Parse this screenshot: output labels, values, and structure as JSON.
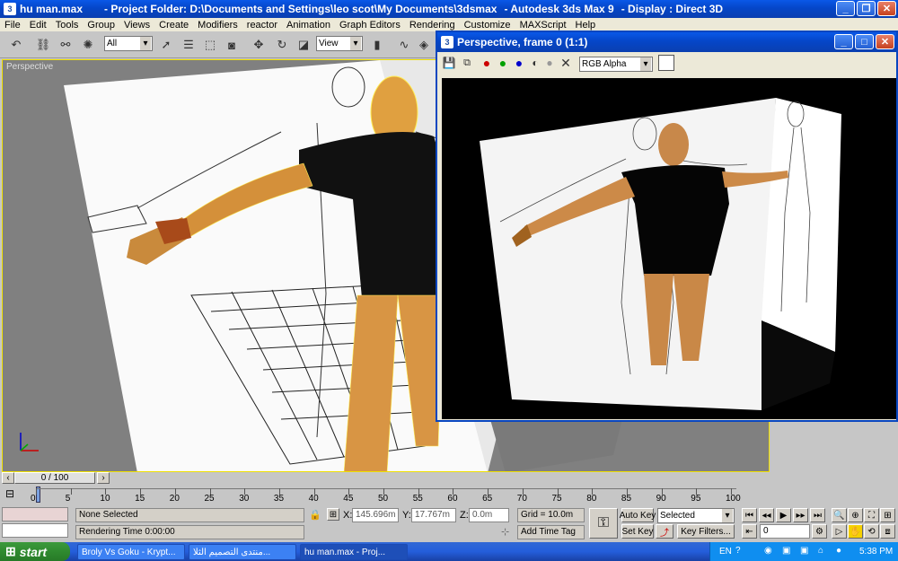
{
  "window": {
    "title_file": "hu man.max",
    "title_project": "- Project Folder: D:\\Documents and Settings\\leo scot\\My Documents\\3dsmax",
    "title_app": "- Autodesk 3ds Max 9",
    "title_display": "- Display : Direct 3D"
  },
  "menu": [
    "File",
    "Edit",
    "Tools",
    "Group",
    "Views",
    "Create",
    "Modifiers",
    "reactor",
    "Animation",
    "Graph Editors",
    "Rendering",
    "Customize",
    "MAXScript",
    "Help"
  ],
  "toolbar": {
    "selection_filter": "All",
    "reference_coord": "View",
    "icons": [
      "undo-icon",
      "select-link-icon",
      "unlink-icon",
      "bind-spacewarp-icon",
      "select-object-icon",
      "select-by-name-icon",
      "rect-region-icon",
      "window-crossing-icon",
      "move-icon",
      "rotate-icon",
      "scale-icon"
    ]
  },
  "viewport": {
    "label": "Perspective"
  },
  "render_window": {
    "title": "Perspective, frame 0 (1:1)",
    "channel": "RGB Alpha",
    "channel_colors": [
      "#cc0000",
      "#00a000",
      "#0000cc"
    ]
  },
  "timeline": {
    "slider_label": "0 / 100",
    "ticks": [
      "0",
      "5",
      "10",
      "15",
      "20",
      "25",
      "30",
      "35",
      "40",
      "45",
      "50",
      "55",
      "60",
      "65",
      "70",
      "75",
      "80",
      "85",
      "90",
      "95",
      "100"
    ]
  },
  "status": {
    "selection": "None Selected",
    "prompt": "Rendering Time  0:00:00",
    "x_label": "X:",
    "x_value": "145.696m",
    "y_label": "Y:",
    "y_value": "17.767m",
    "z_label": "Z:",
    "z_value": "0.0m",
    "grid": "Grid = 10.0m",
    "add_time_tag": "Add Time Tag",
    "auto_key": "Auto Key",
    "set_key": "Set Key",
    "key_mode": "Selected",
    "key_filters": "Key Filters...",
    "frame": "0"
  },
  "taskbar": {
    "start": "start",
    "tasks": [
      "Broly Vs Goku - Krypt...",
      "منتدى التصميم الثلا...",
      "hu man.max    - Proj..."
    ],
    "language": "EN",
    "clock": "5:38 PM"
  }
}
